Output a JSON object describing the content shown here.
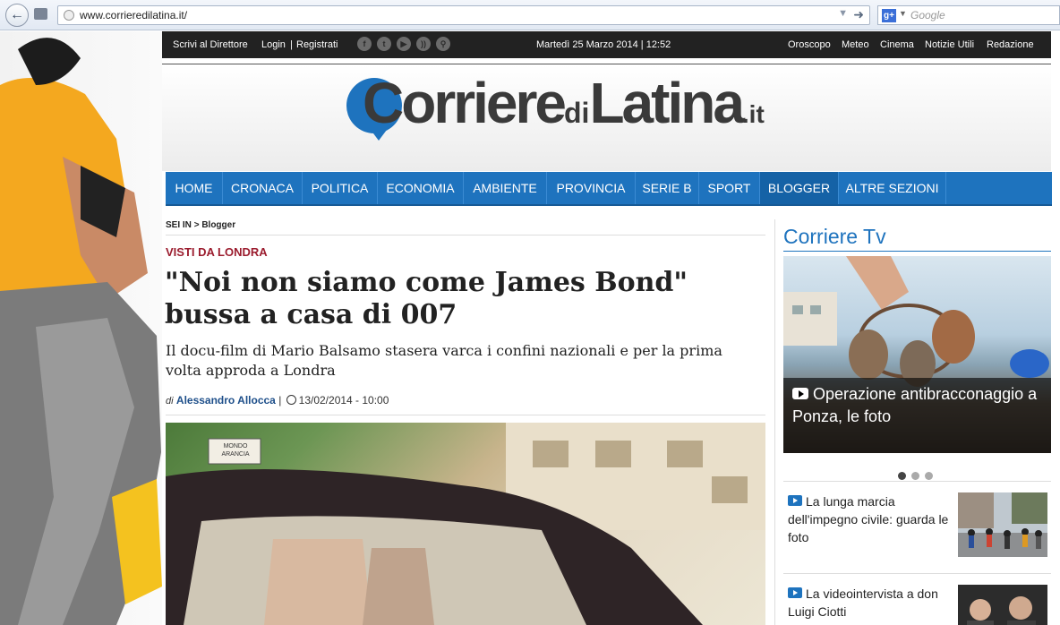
{
  "browser": {
    "url": "www.corrieredilatina.it/",
    "search_placeholder": "Google"
  },
  "topbar": {
    "left_links": [
      "Scrivi al Direttore",
      "Login",
      "|",
      "Registrati"
    ],
    "social_icons": [
      "facebook-icon",
      "twitter-icon",
      "youtube-icon",
      "rss-icon",
      "search-icon"
    ],
    "date": "Martedì 25 Marzo 2014 | 12:52",
    "right_links": [
      "Oroscopo",
      "Meteo",
      "Cinema",
      "Notizie Utili",
      "Redazione"
    ]
  },
  "logo": {
    "part1": "Corriere",
    "part2": "di",
    "part3": "Latina",
    "part4": ".it"
  },
  "nav": {
    "items": [
      "HOME",
      "CRONACA",
      "POLITICA",
      "ECONOMIA",
      "AMBIENTE",
      "PROVINCIA",
      "SERIE B",
      "SPORT",
      "BLOGGER",
      "ALTRE SEZIONI"
    ],
    "active": "BLOGGER"
  },
  "breadcrumb": {
    "label": "SEI IN",
    "sep": ">",
    "current": "Blogger"
  },
  "article": {
    "kicker": "VISTI DA LONDRA",
    "title": "\"Noi non siamo come James Bond\" bussa a casa di 007",
    "subtitle": "Il docu-film di Mario Balsamo stasera varca i confini nazionali e per la prima volta approda a Londra",
    "by_prefix": "di",
    "author": "Alessandro Allocca",
    "sep": "|",
    "datetime": "13/02/2014 - 10:00",
    "photo_sign": "MONDO ARANCIA"
  },
  "sidebar": {
    "tv_title": "Corriere Tv",
    "featured_caption": "Operazione antibracconaggio a Ponza, le foto",
    "slides": 3,
    "active_slide": 1,
    "news": [
      {
        "title": "La lunga marcia dell'impegno civile: guarda le foto"
      },
      {
        "title": "La videointervista a don Luigi Ciotti"
      }
    ]
  },
  "colors": {
    "brand_blue": "#1e73be",
    "kicker_red": "#9b1c2e",
    "topbar_black": "#222222"
  }
}
